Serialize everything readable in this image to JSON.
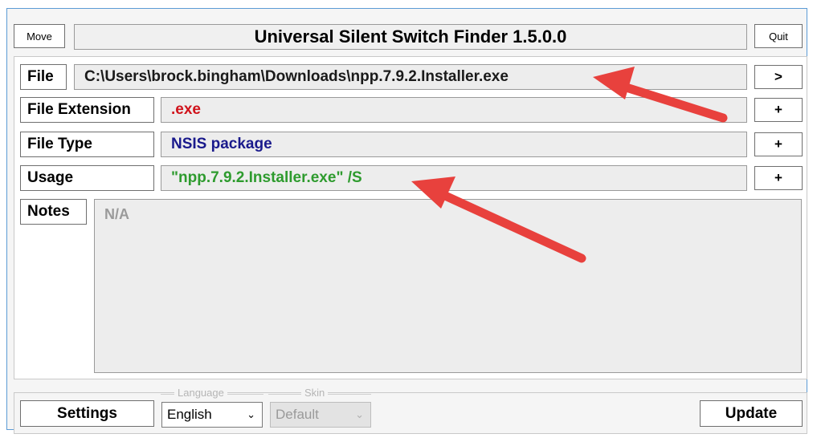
{
  "window": {
    "title": "Universal Silent Switch Finder 1.5.0.0",
    "move_label": "Move",
    "quit_label": "Quit"
  },
  "rows": {
    "file": {
      "label": "File",
      "value": "C:\\Users\\brock.bingham\\Downloads\\npp.7.9.2.Installer.exe",
      "button": ">"
    },
    "extension": {
      "label": "File Extension",
      "value": ".exe",
      "button": "+",
      "value_color": "#d0131b"
    },
    "type": {
      "label": "File Type",
      "value": "NSIS package",
      "button": "+",
      "value_color": "#1a1a8c"
    },
    "usage": {
      "label": "Usage",
      "value": "\"npp.7.9.2.Installer.exe\" /S",
      "button": "+",
      "value_color": "#2e9b2e"
    },
    "notes": {
      "label": "Notes",
      "value": "N/A"
    }
  },
  "footer": {
    "settings_label": "Settings",
    "language_caption": "Language",
    "language_value": "English",
    "skin_caption": "Skin",
    "skin_value": "Default",
    "update_label": "Update"
  },
  "annotations": {
    "arrow_color": "#e8413d",
    "arrow_count": 2
  }
}
